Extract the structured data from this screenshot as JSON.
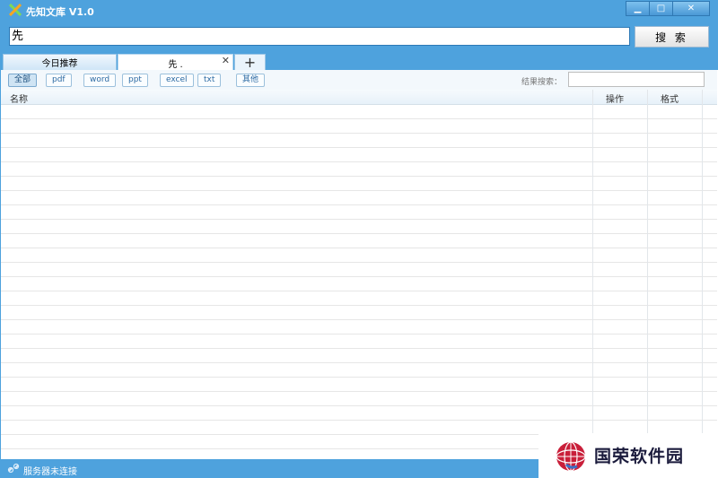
{
  "window": {
    "title": "先知文库 V1.0",
    "controls": {
      "minimize": "▁",
      "maximize": "□",
      "close": "✕"
    }
  },
  "search": {
    "value": "先",
    "button_label": "搜 索"
  },
  "tabs": {
    "today": "今日推荐",
    "active": "先 .",
    "close": "✕",
    "add": "+"
  },
  "filters": {
    "items": [
      "全部",
      "pdf",
      "word",
      "ppt",
      "excel",
      "txt",
      "其他"
    ],
    "selected": "全部",
    "result_search_label": "结果搜索：",
    "result_search_value": ""
  },
  "table": {
    "columns": [
      "名称",
      "操作",
      "格式"
    ],
    "rows": []
  },
  "status": {
    "text": "服务器未连接",
    "icon": "link-broken-icon"
  },
  "watermark": {
    "text": "国荣软件园"
  },
  "colors": {
    "accent": "#4ea2dd",
    "filter_text": "#2d6aa3"
  }
}
